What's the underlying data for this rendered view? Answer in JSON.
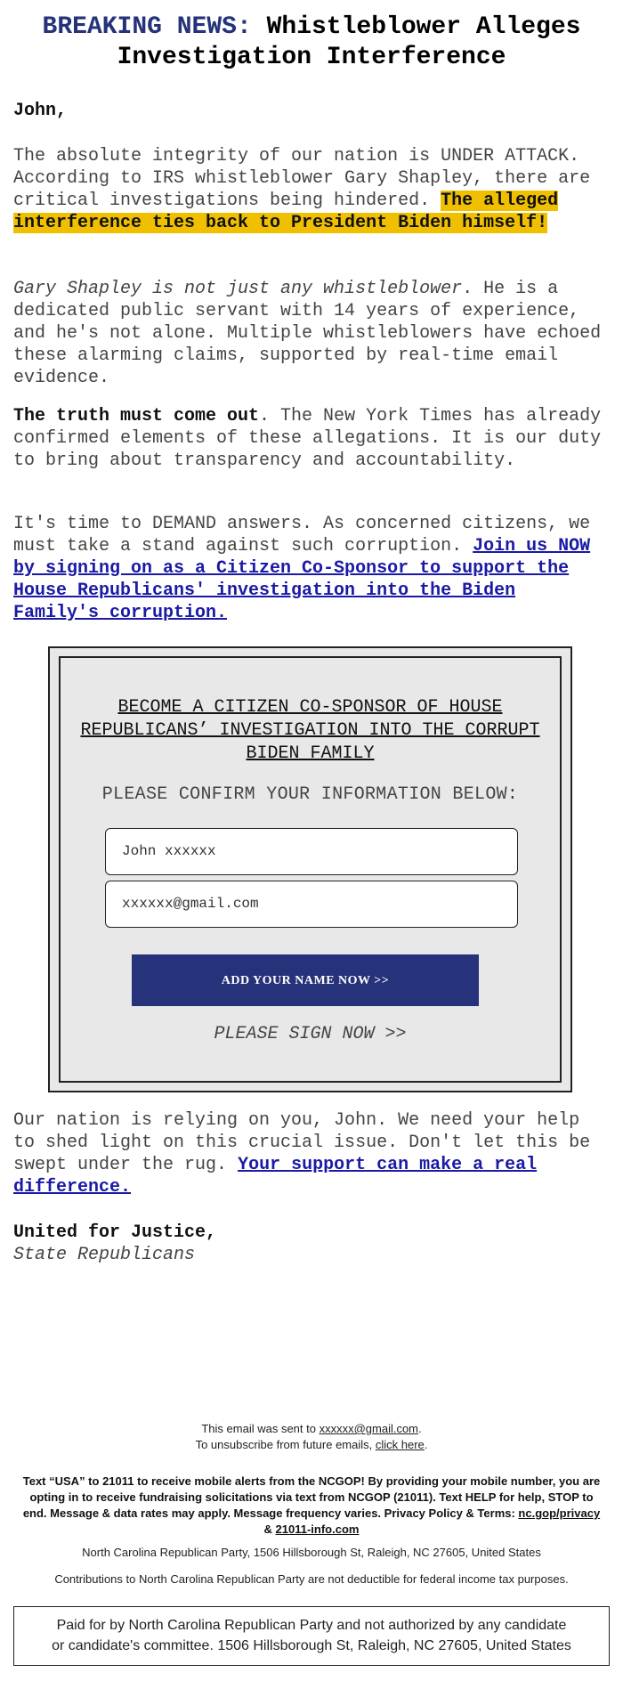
{
  "headline": {
    "prefix": "BREAKING NEWS:",
    "title": "Whistleblower Alleges Investigation Interference",
    "brand_color": "#26327a"
  },
  "greeting": "John,",
  "paragraphs": {
    "p1": {
      "text": "The absolute integrity of our nation is UNDER ATTACK. According to IRS whistleblower Gary Shapley, there are critical investigations being hindered.",
      "highlight": "The alleged interference ties back to President Biden himself!",
      "highlight_color": "#f0c000"
    },
    "p2": {
      "italic": "Gary Shapley is not just any whistleblower",
      "text": ". He is a dedicated public servant with 14 years of experience, and he's not alone. Multiple whistleblowers have echoed these alarming claims, supported by real-time email evidence."
    },
    "p3": {
      "bold": "The truth must come out",
      "text": ". The New York Times has already confirmed elements of these allegations. It is our duty to bring about transparency and accountability."
    },
    "p4": {
      "text": "It's time to DEMAND answers. As concerned citizens, we must take a stand against such corruption.",
      "link": "Join us NOW by signing on as a Citizen Co-Sponsor to support the House Republicans' investigation into the Biden Family's corruption."
    },
    "p5": {
      "text": "Our nation is relying on you, John. We need your help to shed light on this crucial issue. Don't let this be swept under the rug.",
      "link": "Your support can make a real difference."
    }
  },
  "form": {
    "title": "BECOME A CITIZEN CO-SPONSOR OF HOUSE REPUBLICANS’ INVESTIGATION INTO THE CORRUPT BIDEN FAMILY",
    "subtitle": "PLEASE CONFIRM YOUR INFORMATION BELOW:",
    "name_value": "John xxxxxx",
    "email_value": "xxxxxx@gmail.com",
    "button_label": "ADD YOUR NAME NOW >>",
    "button_color": "#26327a",
    "sign_now": "PLEASE SIGN NOW >>"
  },
  "signoff": {
    "line1": "United for Justice,",
    "line2": "State Republicans"
  },
  "footer": {
    "sent_prefix": "This email was sent to ",
    "sent_email": "xxxxxx@gmail.com",
    "sent_suffix": ".",
    "unsub_prefix": "To unsubscribe from future emails, ",
    "unsub_link": "click here",
    "unsub_suffix": ".",
    "sms_text": "Text “USA” to 21011 to receive mobile alerts from the NCGOP! By providing your mobile number, you are opting in to receive fundraising solicitations via text from NCGOP (21011). Text HELP for help, STOP to end. Message & data rates may apply. Message frequency varies. Privacy Policy & Terms: ",
    "privacy_link": "nc.gop/privacy",
    "amp": " & ",
    "terms_link": "21011-info.com",
    "address": "North Carolina Republican Party, 1506 Hillsborough St, Raleigh, NC 27605, United States",
    "contributions": "Contributions to North Carolina Republican Party are not deductible for federal income tax purposes.",
    "paid_for": "Paid for by North Carolina Republican Party and not authorized by any candidate or candidate's committee. 1506 Hillsborough St, Raleigh, NC 27605, United States"
  }
}
